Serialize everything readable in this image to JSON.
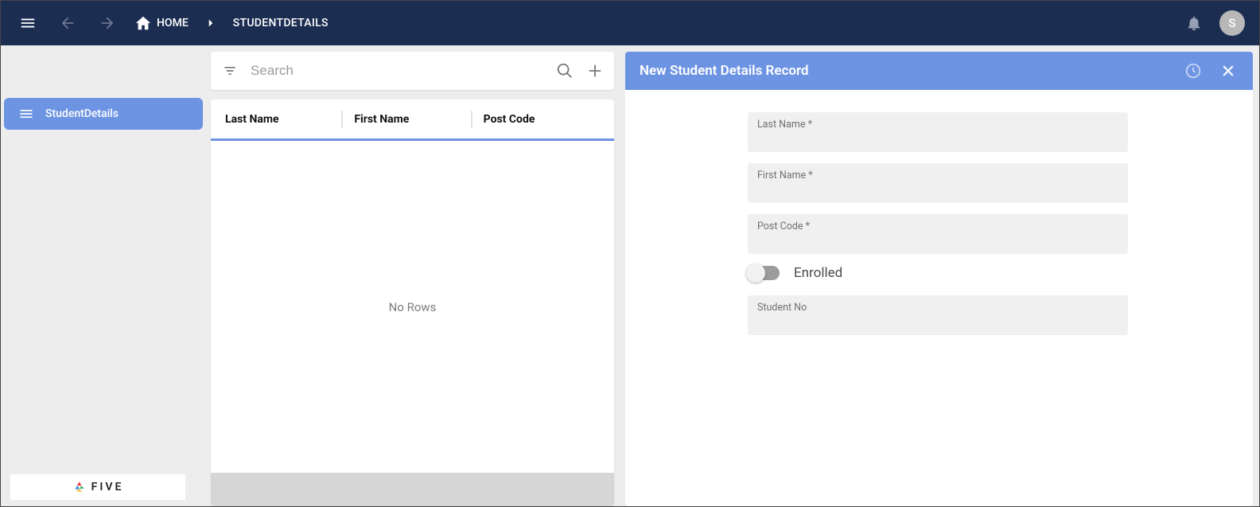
{
  "topbar": {
    "home_label": "HOME",
    "breadcrumb_current": "STUDENTDETAILS",
    "avatar_initial": "S"
  },
  "sidebar": {
    "items": [
      {
        "label": "StudentDetails"
      }
    ],
    "logo_text": "FIVE"
  },
  "list": {
    "search_placeholder": "Search",
    "columns": [
      {
        "label": "Last Name"
      },
      {
        "label": "First Name"
      },
      {
        "label": "Post Code"
      }
    ],
    "empty_text": "No Rows"
  },
  "detail": {
    "title": "New Student Details Record",
    "fields": {
      "last_name_label": "Last Name *",
      "first_name_label": "First Name *",
      "post_code_label": "Post Code *",
      "enrolled_label": "Enrolled",
      "student_no_label": "Student No"
    }
  }
}
